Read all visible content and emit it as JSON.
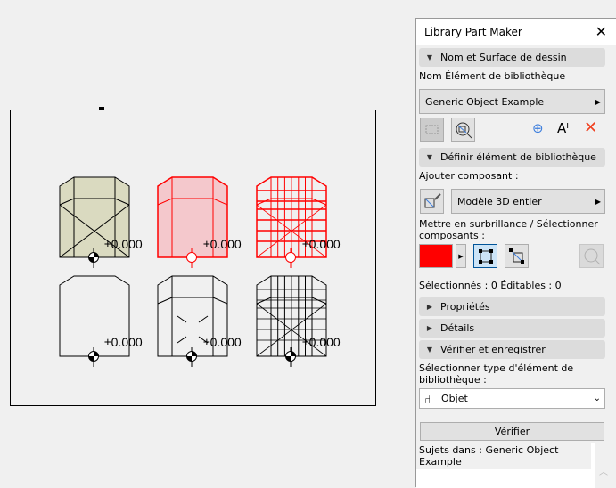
{
  "panel": {
    "title": "Library Part Maker",
    "sec1": "Nom et Surface de dessin",
    "name_label": "Nom Élément de bibliothèque",
    "name_value": "Generic Object Example",
    "sec2": "Définir élément de bibliothèque",
    "add_label": "Ajouter composant :",
    "add_value": "Modèle 3D entier",
    "highlight_label_1": "Mettre en surbrillance / Sélectionner",
    "highlight_label_2": "composants :",
    "highlight_color": "#ff0000",
    "selected": "Sélectionnés : 0 Éditables : 0",
    "sec3": "Propriétés",
    "sec4": "Détails",
    "sec5": "Vérifier et enregistrer",
    "type_label_1": "Sélectionner type d'élément de",
    "type_label_2": "bibliothèque :",
    "type_value": "Objet",
    "verify": "Vérifier",
    "subjects": "Sujets dans : Generic Object Example"
  },
  "drawing": {
    "elevation_labels": [
      "±0.000",
      "±0.000",
      "±0.000",
      "±0.000",
      "±0.000",
      "±0.000"
    ]
  }
}
